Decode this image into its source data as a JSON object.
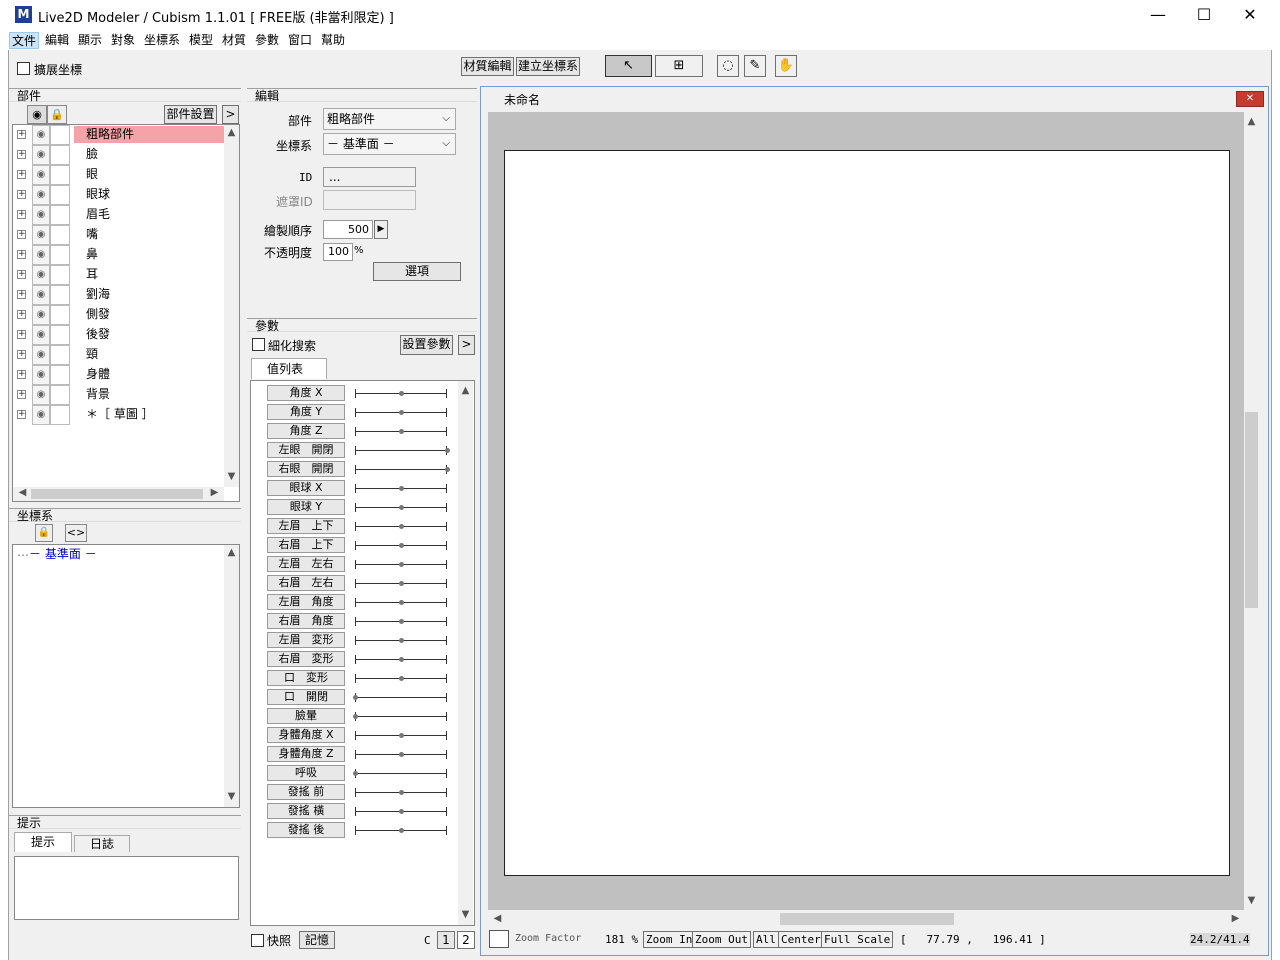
{
  "window": {
    "title": "Live2D Modeler / Cubism 1.1.01  [ FREE版 (非當利限定) ]",
    "app_icon": "M",
    "minimize": "—",
    "maximize": "☐",
    "close": "✕"
  },
  "menu": [
    "文件",
    "編輯",
    "顯示",
    "對象",
    "坐標系",
    "模型",
    "材質",
    "參數",
    "窗口",
    "幫助"
  ],
  "toolbar": {
    "extend_coords": "擴展坐標",
    "texture_edit": "材質編輯",
    "create_coords": "建立坐標系"
  },
  "parts_panel": {
    "title": "部件",
    "settings_button": "部件設置",
    "more_button": ">",
    "items": [
      "粗略部件",
      "臉",
      "眼",
      "眼球",
      "眉毛",
      "嘴",
      "鼻",
      "耳",
      "劉海",
      "側發",
      "後發",
      "頸",
      "身體",
      "背景",
      "＊［ 草圖 ］"
    ],
    "selected_index": 0
  },
  "coords_panel": {
    "title": "坐標系",
    "tree_item": "－ 基準面 －"
  },
  "hints_panel": {
    "title": "提示",
    "tabs": [
      "提示",
      "日誌"
    ]
  },
  "edit_panel": {
    "title": "編輯",
    "part_label": "部件",
    "part_value": "粗略部件",
    "coords_label": "坐標系",
    "coords_value": "－ 基準面 －",
    "id_label": "ID",
    "id_value": "...",
    "mask_id_label": "遮罩ID",
    "mask_id_value": "",
    "draw_order_label": "繪製順序",
    "draw_order_value": "500",
    "opacity_label": "不透明度",
    "opacity_value": "100",
    "opacity_unit": "%",
    "options_button": "選項"
  },
  "params_panel": {
    "title": "參數",
    "refine_search": "細化搜索",
    "set_params_button": "設置參數",
    "more_button": ">",
    "tab": "值列表",
    "items": [
      {
        "name": "角度 X",
        "value": 0.5
      },
      {
        "name": "角度 Y",
        "value": 0.5
      },
      {
        "name": "角度 Z",
        "value": 0.5
      },
      {
        "name": "左眼　開閉",
        "value": 1.0
      },
      {
        "name": "右眼　開閉",
        "value": 1.0
      },
      {
        "name": "眼球 X",
        "value": 0.5
      },
      {
        "name": "眼球 Y",
        "value": 0.5
      },
      {
        "name": "左眉　上下",
        "value": 0.5
      },
      {
        "name": "右眉　上下",
        "value": 0.5
      },
      {
        "name": "左眉　左右",
        "value": 0.5
      },
      {
        "name": "右眉　左右",
        "value": 0.5
      },
      {
        "name": "左眉　角度",
        "value": 0.5
      },
      {
        "name": "右眉　角度",
        "value": 0.5
      },
      {
        "name": "左眉　変形",
        "value": 0.5
      },
      {
        "name": "右眉　変形",
        "value": 0.5
      },
      {
        "name": "口　変形",
        "value": 0.5
      },
      {
        "name": "口　開閉",
        "value": 0.0
      },
      {
        "name": "臉暈",
        "value": 0.0
      },
      {
        "name": "身體角度 X",
        "value": 0.5
      },
      {
        "name": "身體角度 Z",
        "value": 0.5
      },
      {
        "name": "呼吸",
        "value": 0.0
      },
      {
        "name": "發搖 前",
        "value": 0.5
      },
      {
        "name": "發搖 橫",
        "value": 0.5
      },
      {
        "name": "發搖 後",
        "value": 0.5
      }
    ],
    "snapshot": "快照",
    "memory_button": "記憶",
    "c_label": "C",
    "page1": "1",
    "page2": "2"
  },
  "canvas_window": {
    "title": "未命名",
    "close": "✕",
    "zoom_factor_label": "Zoom Factor",
    "zoom_value": "181 %",
    "zoom_in": "Zoom In",
    "zoom_out": "Zoom Out",
    "all": "All",
    "center": "Center",
    "full_scale": "Full Scale",
    "coords_readout": "[   77.79 ,   196.41 ]",
    "fps": "24.2/41.4"
  },
  "colors": {
    "selection": "#f5a3a8",
    "canvas_bg": "#ffffff",
    "canvas_surround": "#c0c0c0",
    "app_icon": "#1f3f8f"
  }
}
